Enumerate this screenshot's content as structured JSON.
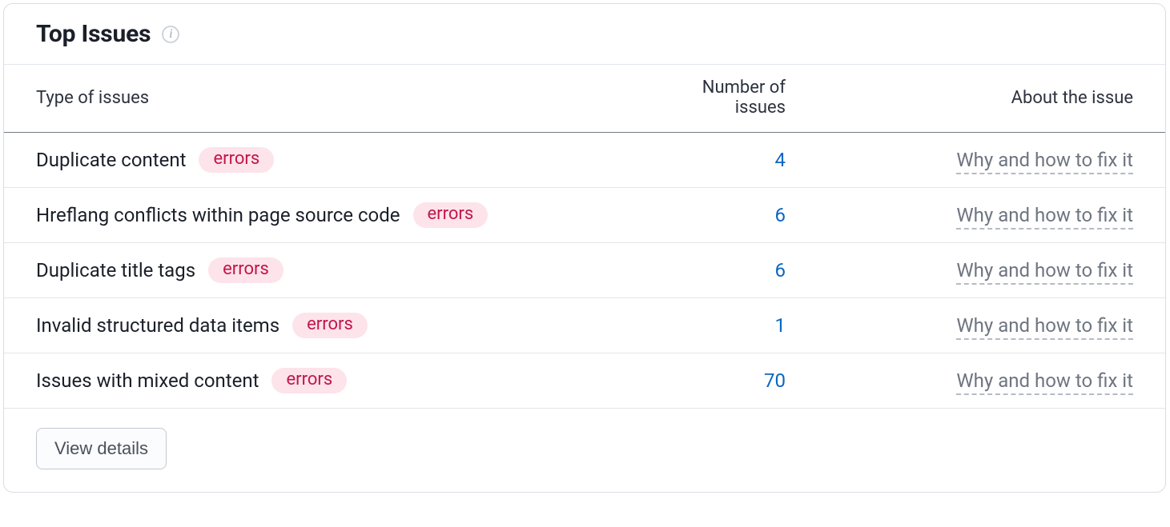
{
  "header": {
    "title": "Top Issues"
  },
  "columns": {
    "type": "Type of issues",
    "number": "Number of issues",
    "about": "About the issue"
  },
  "rows": [
    {
      "name": "Duplicate content",
      "badge": "errors",
      "count": "4",
      "fix_label": "Why and how to fix it"
    },
    {
      "name": "Hreflang conflicts within page source code",
      "badge": "errors",
      "count": "6",
      "fix_label": "Why and how to fix it"
    },
    {
      "name": "Duplicate title tags",
      "badge": "errors",
      "count": "6",
      "fix_label": "Why and how to fix it"
    },
    {
      "name": "Invalid structured data items",
      "badge": "errors",
      "count": "1",
      "fix_label": "Why and how to fix it"
    },
    {
      "name": "Issues with mixed content",
      "badge": "errors",
      "count": "70",
      "fix_label": "Why and how to fix it"
    }
  ],
  "footer": {
    "view_details": "View details"
  }
}
